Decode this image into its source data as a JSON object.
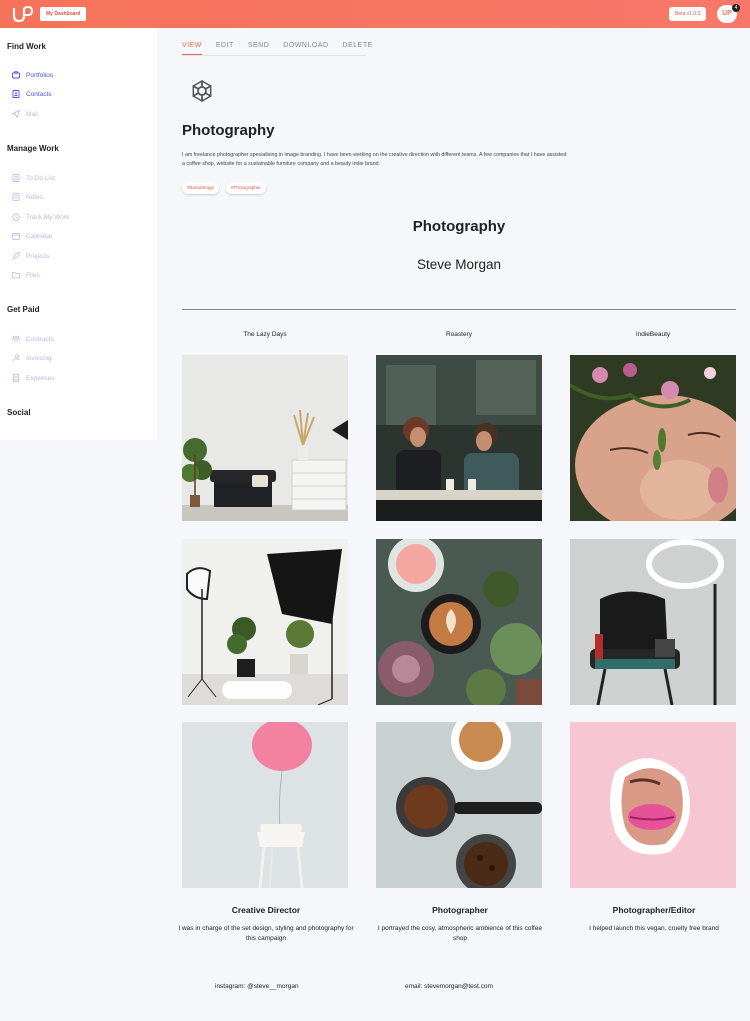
{
  "header": {
    "logo_icon": "up-logo-icon",
    "dashboard_label": "My Dashboard",
    "beta_label": "Beta v1.0.0",
    "avatar_text": "UP",
    "notification_count": "4",
    "accent_color": "#f5735a"
  },
  "sidebar": {
    "sections": [
      {
        "title": "Find Work",
        "items": [
          {
            "label": "Portfolios",
            "icon": "briefcase-icon",
            "active": true
          },
          {
            "label": "Contacts",
            "icon": "contact-card-icon",
            "active": true
          },
          {
            "label": "Mail",
            "icon": "paper-plane-icon",
            "active": false
          }
        ]
      },
      {
        "title": "Manage Work",
        "items": [
          {
            "label": "To Do List",
            "icon": "checklist-icon"
          },
          {
            "label": "Notes",
            "icon": "notes-icon"
          },
          {
            "label": "Track My Work",
            "icon": "clock-icon"
          },
          {
            "label": "Calendar",
            "icon": "calendar-icon"
          },
          {
            "label": "Projects",
            "icon": "rocket-icon"
          },
          {
            "label": "Files",
            "icon": "folder-icon"
          }
        ]
      },
      {
        "title": "Get Paid",
        "items": [
          {
            "label": "Contracts",
            "icon": "scales-icon"
          },
          {
            "label": "Invoicing",
            "icon": "hand-coin-icon"
          },
          {
            "label": "Expenses",
            "icon": "receipt-icon"
          }
        ]
      },
      {
        "title": "Social",
        "items": []
      }
    ]
  },
  "tabs": [
    "VIEW",
    "EDIT",
    "SEND",
    "DOWNLOAD",
    "DELETE"
  ],
  "active_tab": "VIEW",
  "portfolio": {
    "icon": "aperture-icon",
    "title": "Photography",
    "description": "I am freelance photographer specialising in image branding. I have been working on the creative direction with different teams. A few companies that I have assisted: a coffee shop, website for a sustainable furniture company and a beauty indie brand.",
    "tags": [
      "#BrandImage",
      "#Photographer"
    ],
    "section_title": "Photography",
    "person_name": "Steve Morgan",
    "columns": [
      {
        "label": "The Lazy Days",
        "role": "Creative Director",
        "role_desc": "I was in charge of the set design, styling and photography for this campaign"
      },
      {
        "label": "Roastery",
        "role": "Photographer",
        "role_desc": "I portrayed the cosy, atmospheric ambience of this coffee shop"
      },
      {
        "label": "IndieBeauty",
        "role": "Photographer/Editor",
        "role_desc": "I helped launch this vegan, cruelty free brand"
      }
    ],
    "photos": [
      "living-room-photo",
      "cafe-couple-photo",
      "face-flowers-photo",
      "studio-lights-photo",
      "latte-succulents-photo",
      "salon-chair-photo",
      "pink-balloon-photo",
      "coffee-portafilter-photo",
      "pink-lips-photo"
    ],
    "instagram": "instagram: @steve__morgan",
    "email": "email: stevemorgan@test.com"
  }
}
